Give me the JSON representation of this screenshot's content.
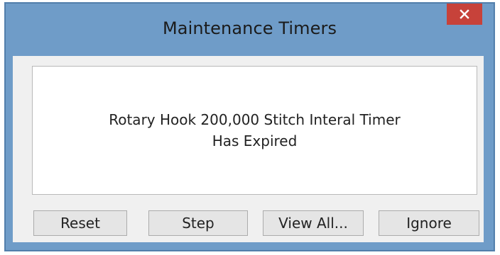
{
  "window": {
    "title": "Maintenance Timers",
    "close_icon": "close-icon"
  },
  "message": {
    "line1": "Rotary Hook 200,000 Stitch Interal Timer",
    "line2": "Has Expired"
  },
  "buttons": {
    "reset": "Reset",
    "step": "Step",
    "view_all": "View All...",
    "ignore": "Ignore"
  },
  "colors": {
    "frame": "#6f9cc8",
    "close_button": "#c7423a",
    "client_background": "#f0f0f0",
    "button_face": "#e5e5e5"
  }
}
